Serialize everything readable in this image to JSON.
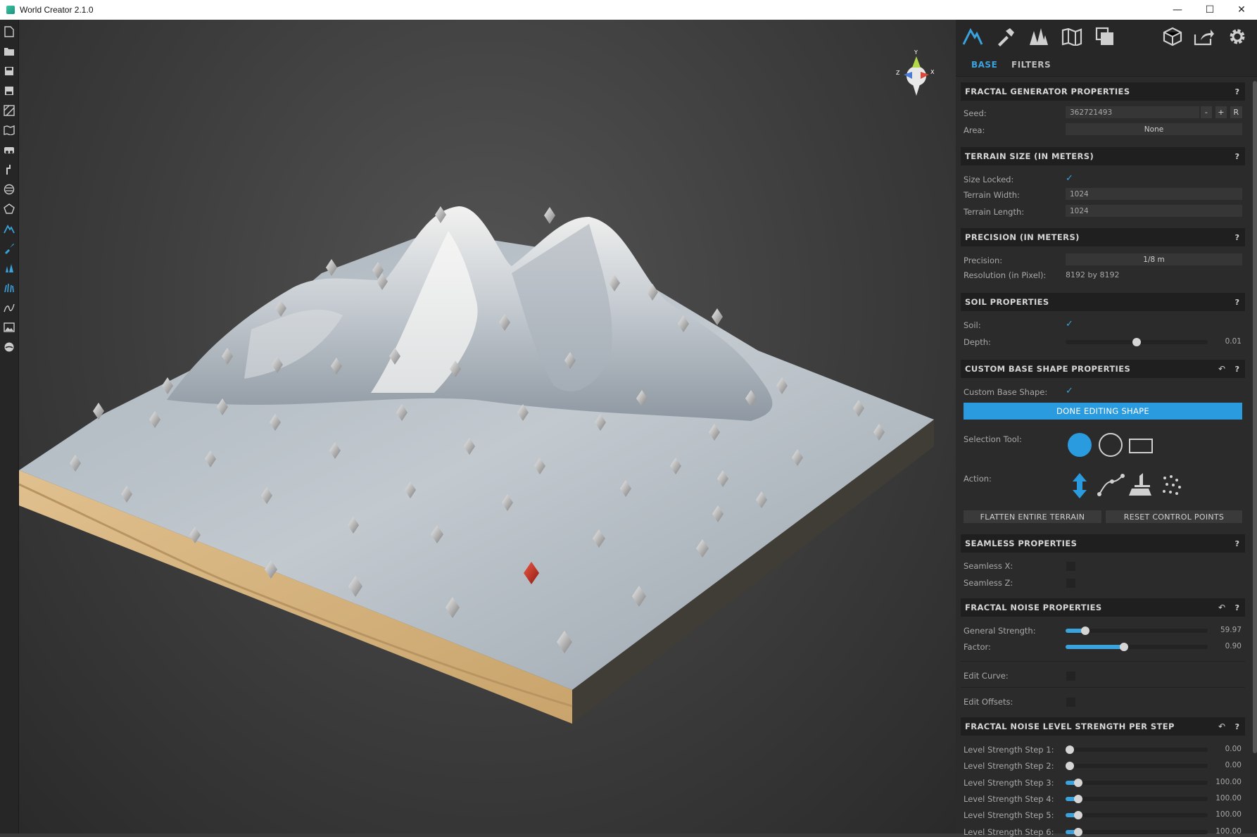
{
  "window": {
    "title": "World Creator 2.1.0",
    "minimize": "—",
    "maximize": "☐",
    "close": "✕"
  },
  "left_toolbar": [
    "new-file-icon",
    "open-folder-icon",
    "save-icon",
    "save-as-icon",
    "terrain-layers-icon",
    "map-icon",
    "camera-icon",
    "brush-tool-icon",
    "globe-icon",
    "pentagon-icon",
    "mountain-icon",
    "paint-icon",
    "tree-icon",
    "grass-icon",
    "erosion-icon",
    "image-icon",
    "sphere-icon"
  ],
  "top_tools": [
    "mountain-icon",
    "hammer-icon",
    "trees-icon",
    "map-icon",
    "layers-icon",
    "cube-export-icon",
    "share-icon",
    "settings-gear-icon"
  ],
  "tabs": {
    "base": "BASE",
    "filters": "FILTERS"
  },
  "fractal_generator": {
    "title": "FRACTAL GENERATOR PROPERTIES",
    "help": "?",
    "seed_label": "Seed:",
    "seed_value": "362721493",
    "seed_minus": "-",
    "seed_plus": "+",
    "seed_random": "R",
    "area_label": "Area:",
    "area_value": "None"
  },
  "terrain_size": {
    "title": "TERRAIN SIZE (IN METERS)",
    "help": "?",
    "size_locked_label": "Size Locked:",
    "size_locked": true,
    "width_label": "Terrain Width:",
    "width_value": "1024",
    "length_label": "Terrain Length:",
    "length_value": "1024"
  },
  "precision": {
    "title": "PRECISION (IN METERS)",
    "help": "?",
    "precision_label": "Precision:",
    "precision_value": "1/8 m",
    "resolution_label": "Resolution (in Pixel):",
    "resolution_value": "8192 by 8192"
  },
  "soil": {
    "title": "SOIL PROPERTIES",
    "help": "?",
    "soil_label": "Soil:",
    "soil_checked": true,
    "depth_label": "Depth:",
    "depth_value": "0.01",
    "depth_fraction": 0.5
  },
  "custom_base": {
    "title": "CUSTOM BASE SHAPE PROPERTIES",
    "help": "?",
    "undo": "↶",
    "custom_label": "Custom Base Shape:",
    "custom_checked": true,
    "done_button": "DONE EDITING SHAPE",
    "selection_label": "Selection Tool:",
    "selection_tools": [
      "filled-circle-icon",
      "circle-outline-icon",
      "rectangle-icon"
    ],
    "action_label": "Action:",
    "actions": [
      "raise-lower-arrows-icon",
      "path-points-icon",
      "flatten-icon",
      "scatter-points-icon"
    ],
    "flatten_button": "FLATTEN ENTIRE TERRAIN",
    "reset_button": "RESET CONTROL POINTS"
  },
  "seamless": {
    "title": "SEAMLESS PROPERTIES",
    "help": "?",
    "x_label": "Seamless X:",
    "z_label": "Seamless Z:"
  },
  "fractal_noise": {
    "title": "FRACTAL NOISE PROPERTIES",
    "help": "?",
    "undo": "↶",
    "strength_label": "General Strength:",
    "strength_value": "59.97",
    "strength_fraction": 0.14,
    "factor_label": "Factor:",
    "factor_value": "0.90",
    "factor_fraction": 0.41,
    "curve_label": "Edit Curve:",
    "offsets_label": "Edit Offsets:"
  },
  "level_strength": {
    "title": "FRACTAL NOISE LEVEL STRENGTH PER STEP",
    "help": "?",
    "undo": "↶",
    "steps": [
      {
        "label": "Level Strength Step 1:",
        "value": "0.00",
        "fraction": 0.03
      },
      {
        "label": "Level Strength Step 2:",
        "value": "0.00",
        "fraction": 0.03
      },
      {
        "label": "Level Strength Step 3:",
        "value": "100.00",
        "fraction": 0.09
      },
      {
        "label": "Level Strength Step 4:",
        "value": "100.00",
        "fraction": 0.09
      },
      {
        "label": "Level Strength Step 5:",
        "value": "100.00",
        "fraction": 0.09
      },
      {
        "label": "Level Strength Step 6:",
        "value": "100.00",
        "fraction": 0.09
      }
    ]
  },
  "gizmo": {
    "y": "Y",
    "x": "X",
    "z": "Z"
  },
  "colors": {
    "accent": "#2b9be0",
    "panel": "#2b2b2b",
    "header": "#1f1f1f",
    "selected_point": "#c0281c"
  }
}
